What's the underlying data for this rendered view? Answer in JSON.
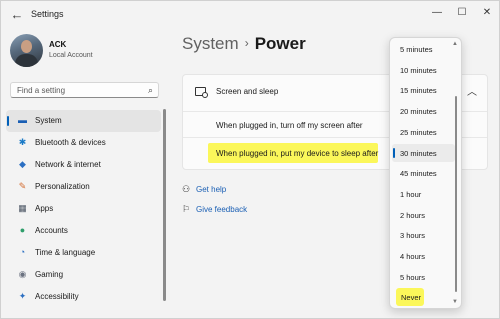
{
  "window": {
    "title": "Settings",
    "back_icon": "arrow-left-icon",
    "controls": {
      "minimize": "—",
      "maximize": "☐",
      "close": "✕"
    }
  },
  "user": {
    "name": "ACK",
    "account_type": "Local Account"
  },
  "search": {
    "placeholder": "Find a setting",
    "icon": "⌕"
  },
  "sidebar": {
    "items": [
      {
        "label": "System",
        "icon": "▬",
        "icon_color": "#1a5fb4",
        "active": true
      },
      {
        "label": "Bluetooth & devices",
        "icon": "✱",
        "icon_color": "#1a7ac7",
        "active": false
      },
      {
        "label": "Network & internet",
        "icon": "◆",
        "icon_color": "#2b6fc2",
        "active": false
      },
      {
        "label": "Personalization",
        "icon": "✎",
        "icon_color": "#d36b2f",
        "active": false
      },
      {
        "label": "Apps",
        "icon": "▦",
        "icon_color": "#4b5563",
        "active": false
      },
      {
        "label": "Accounts",
        "icon": "●",
        "icon_color": "#2f9e6b",
        "active": false
      },
      {
        "label": "Time & language",
        "icon": "◔",
        "icon_color": "#2b6fc2",
        "active": false
      },
      {
        "label": "Gaming",
        "icon": "◉",
        "icon_color": "#6b7280",
        "active": false
      },
      {
        "label": "Accessibility",
        "icon": "✦",
        "icon_color": "#2b6fc2",
        "active": false
      }
    ]
  },
  "breadcrumb": {
    "parent": "System",
    "separator": "›",
    "current": "Power"
  },
  "screen_sleep": {
    "title": "Screen and sleep",
    "chevron": "︿",
    "row1": "When plugged in, turn off my screen after",
    "row2": "When plugged in, put my device to sleep after"
  },
  "links": {
    "help": "Get help",
    "feedback": "Give feedback"
  },
  "dropdown": {
    "options": [
      "5 minutes",
      "10 minutes",
      "15 minutes",
      "20 minutes",
      "25 minutes",
      "30 minutes",
      "45 minutes",
      "1 hour",
      "2 hours",
      "3 hours",
      "4 hours",
      "5 hours",
      "Never"
    ],
    "selected": "30 minutes",
    "highlighted": "Never"
  },
  "colors": {
    "accent": "#005fb8",
    "highlight": "#fbf75a"
  }
}
